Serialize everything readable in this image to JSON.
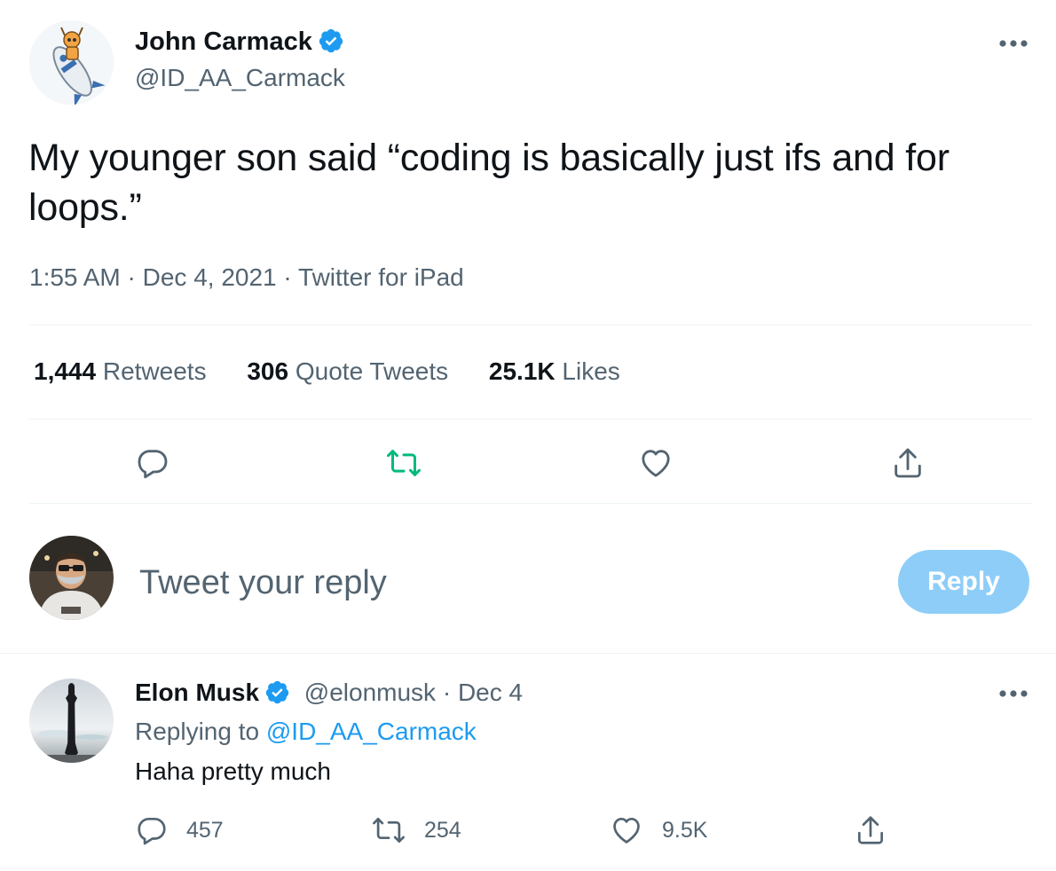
{
  "main_tweet": {
    "author": {
      "display_name": "John Carmack",
      "handle": "@ID_AA_Carmack",
      "verified": true
    },
    "text": "My younger son said “coding is basically just ifs and for loops.”",
    "time": "1:55 AM",
    "date": "Dec 4, 2021",
    "source": "Twitter for iPad",
    "stats": {
      "retweets_count": "1,444",
      "retweets_label": "Retweets",
      "quote_count": "306",
      "quote_label": "Quote Tweets",
      "likes_count": "25.1K",
      "likes_label": "Likes"
    },
    "actions": [
      "reply-icon",
      "retweet-icon",
      "like-icon",
      "share-icon"
    ],
    "retweet_icon_color": "#00ba7c"
  },
  "composer": {
    "placeholder": "Tweet your reply",
    "button_label": "Reply",
    "button_color": "#8ecdf8"
  },
  "reply_tweet": {
    "author": {
      "display_name": "Elon Musk",
      "handle": "@elonmusk",
      "verified": true
    },
    "date": "Dec 4",
    "replying_prefix": "Replying to",
    "replying_to": "@ID_AA_Carmack",
    "text": "Haha pretty much",
    "reply_count": "457",
    "retweet_count": "254",
    "like_count": "9.5K"
  },
  "colors": {
    "text_primary": "#0f1419",
    "text_secondary": "#536471",
    "link": "#1d9bf0",
    "verified": "#1d9bf0",
    "divider": "#eff3f4"
  }
}
